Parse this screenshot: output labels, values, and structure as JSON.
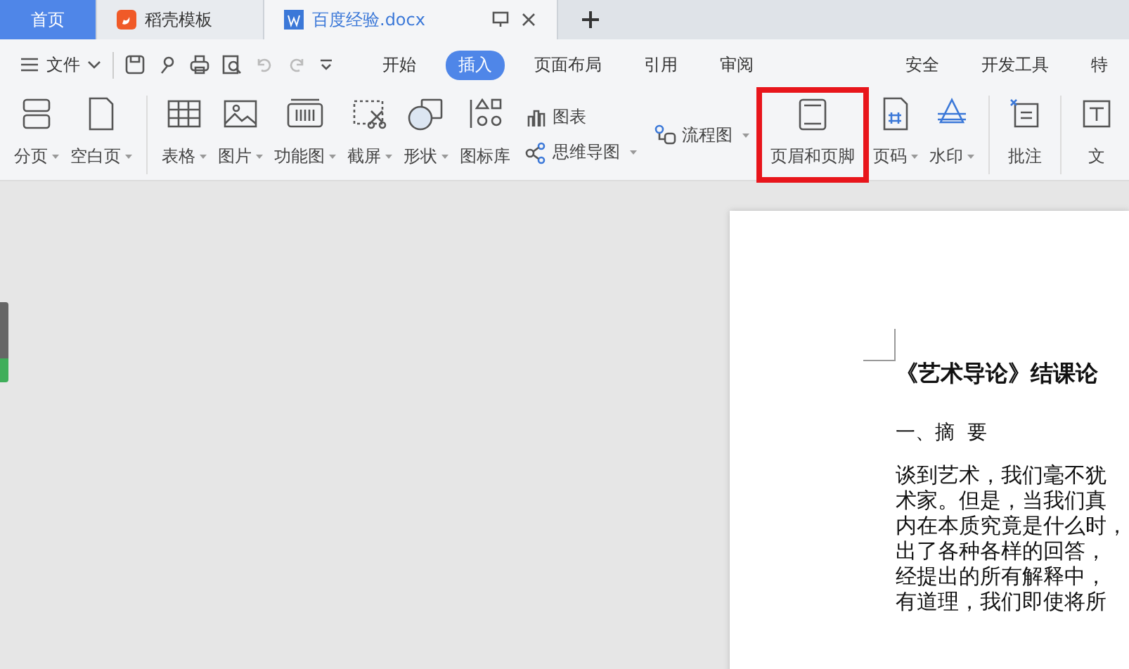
{
  "tabs": [
    {
      "label": "首页",
      "kind": "home",
      "selected": false
    },
    {
      "label": "稻壳模板",
      "kind": "app",
      "selected": false
    },
    {
      "label": "百度经验.docx",
      "kind": "doc",
      "selected": true
    }
  ],
  "menu": {
    "label": "文件"
  },
  "ribbon_tabs": [
    {
      "label": "开始",
      "selected": false
    },
    {
      "label": "插入",
      "selected": true
    },
    {
      "label": "页面布局",
      "selected": false
    },
    {
      "label": "引用",
      "selected": false
    },
    {
      "label": "审阅",
      "selected": false
    },
    {
      "label": "安全",
      "selected": false
    },
    {
      "label": "开发工具",
      "selected": false
    },
    {
      "label": "特",
      "selected": false
    }
  ],
  "ribbon": [
    {
      "kind": "large",
      "label": "分页",
      "dropdown": true,
      "highlighted": false
    },
    {
      "kind": "large",
      "label": "空白页",
      "dropdown": true,
      "highlighted": false
    },
    {
      "kind": "divider"
    },
    {
      "kind": "large",
      "label": "表格",
      "dropdown": true,
      "highlighted": false
    },
    {
      "kind": "large",
      "label": "图片",
      "dropdown": true,
      "highlighted": false
    },
    {
      "kind": "large",
      "label": "功能图",
      "dropdown": true,
      "highlighted": false
    },
    {
      "kind": "large",
      "label": "截屏",
      "dropdown": true,
      "highlighted": false
    },
    {
      "kind": "large",
      "label": "形状",
      "dropdown": true,
      "highlighted": false
    },
    {
      "kind": "large",
      "label": "图标库",
      "dropdown": false,
      "highlighted": false
    },
    {
      "kind": "small",
      "label": "图表",
      "dropdown": false
    },
    {
      "kind": "small",
      "label": "思维导图",
      "dropdown": true
    },
    {
      "kind": "small",
      "label": "流程图",
      "dropdown": true
    },
    {
      "kind": "large",
      "label": "页眉和页脚",
      "dropdown": false,
      "highlighted": true
    },
    {
      "kind": "large",
      "label": "页码",
      "dropdown": true,
      "highlighted": false
    },
    {
      "kind": "large",
      "label": "水印",
      "dropdown": true,
      "highlighted": false
    },
    {
      "kind": "divider"
    },
    {
      "kind": "large",
      "label": "批注",
      "dropdown": false,
      "highlighted": false
    },
    {
      "kind": "divider"
    },
    {
      "kind": "large",
      "label": "文",
      "dropdown": false,
      "highlighted": false
    }
  ],
  "document": {
    "title": "《艺术导论》结课论",
    "heading": "一、摘  要",
    "lines": [
      "谈到艺术，我们毫不犹",
      "术家。但是，当我们真",
      "内在本质究竟是什么时，",
      "出了各种各样的回答，",
      "经提出的所有解释中，",
      "有道理，我们即使将所"
    ]
  }
}
